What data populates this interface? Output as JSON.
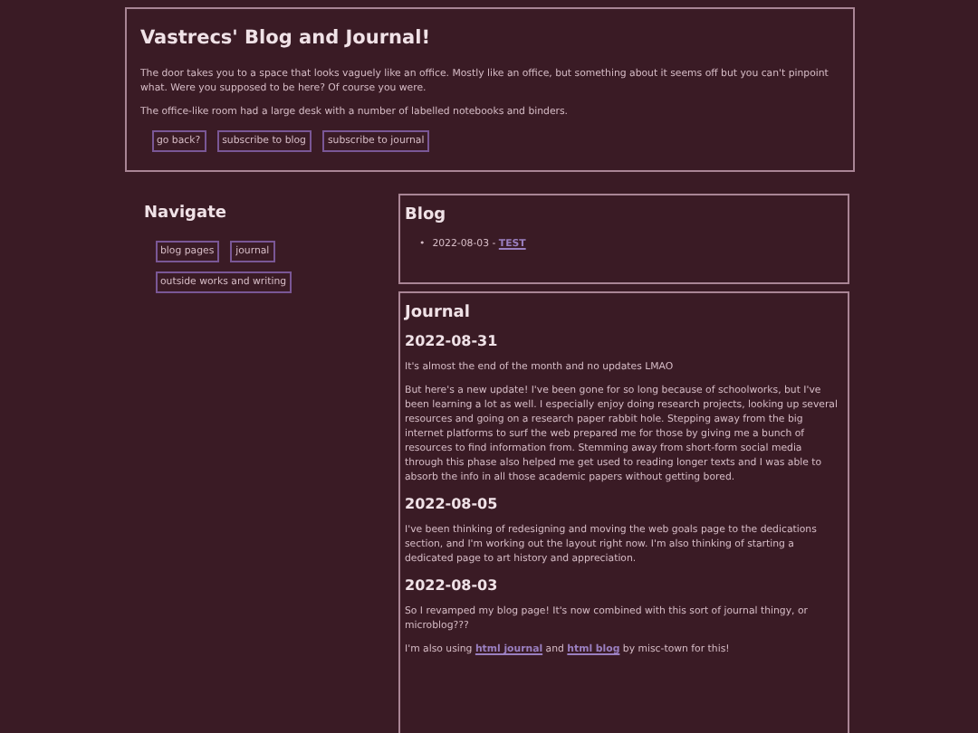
{
  "intro": {
    "title": "Vastrecs' Blog and Journal!",
    "paragraphs": [
      "The door takes you to a space that looks vaguely like an office. Mostly like an office, but something about it seems off but you can't pinpoint what. Were you supposed to be here? Of course you were.",
      "The office-like room had a large desk with a number of labelled notebooks and binders."
    ],
    "buttons": [
      "go back?",
      "subscribe to blog",
      "subscribe to journal"
    ]
  },
  "navigate": {
    "title": "Navigate",
    "buttons": [
      "blog pages",
      "journal",
      "outside works and writing"
    ]
  },
  "blog": {
    "title": "Blog",
    "items": [
      {
        "marker": "•",
        "date": "2022-08-03",
        "separator": "-",
        "link": "TEST"
      }
    ]
  },
  "journal": {
    "title": "Journal",
    "entries": [
      {
        "date": "2022-08-31",
        "paragraphs": [
          {
            "kind": "plain",
            "text": "It's almost the end of the month and no updates LMAO"
          },
          {
            "kind": "plain",
            "text": "But here's a new update! I've been gone for so long because of schoolworks, but I've been learning a lot as well. I especially enjoy doing research projects, looking up several resources and going on a research paper rabbit hole. Stepping away from the big internet platforms to surf the web prepared me for those by giving me a bunch of resources to find information from. Stemming away from short-form social media through this phase also helped me get used to reading longer texts and I was able to absorb the info in all those academic papers without getting bored."
          }
        ]
      },
      {
        "date": "2022-08-05",
        "paragraphs": [
          {
            "kind": "plain",
            "text": "I've been thinking of redesigning and moving the web goals page to the dedications section, and I'm working out the layout right now. I'm also thinking of starting a dedicated page to art history and appreciation."
          }
        ]
      },
      {
        "date": "2022-08-03",
        "paragraphs": [
          {
            "kind": "plain",
            "text": "So I revamped my blog page! It's now combined with this sort of journal thingy, or microblog???"
          },
          {
            "kind": "linked",
            "segments": [
              {
                "kind": "text",
                "text": "I'm also using"
              },
              {
                "kind": "link",
                "text": "html journal"
              },
              {
                "kind": "text",
                "text": "and"
              },
              {
                "kind": "link",
                "text": "html blog"
              },
              {
                "kind": "text",
                "text": "by misc-town for this!"
              }
            ]
          }
        ]
      }
    ]
  }
}
